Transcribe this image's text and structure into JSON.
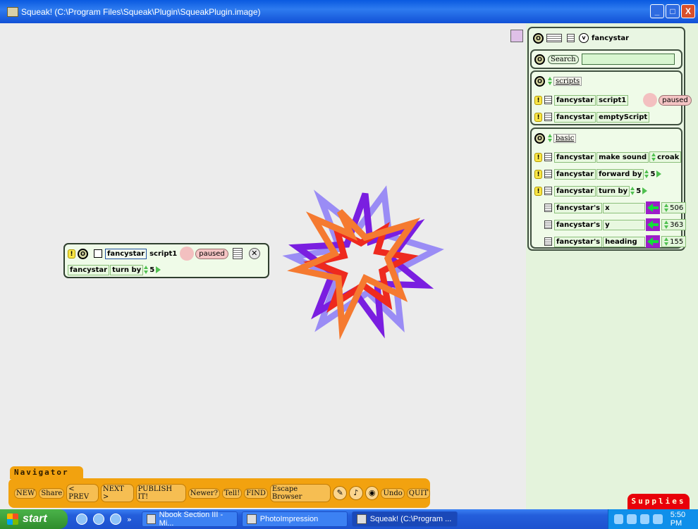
{
  "window": {
    "title": "Squeak! (C:\\Program Files\\Squeak\\Plugin\\SqueakPlugin.image)",
    "controls": {
      "minimize": "_",
      "maximize": "□",
      "close": "X"
    }
  },
  "viewer": {
    "object_name": "fancystar",
    "var_badge": "v",
    "search_button": "Search",
    "search_value": "",
    "scripts_category": {
      "label": "scripts",
      "rows": [
        {
          "subject": "fancystar",
          "command": "script1",
          "status": "paused"
        },
        {
          "subject": "fancystar",
          "command": "emptyScript"
        }
      ]
    },
    "basic_category": {
      "label": "basic",
      "commands": [
        {
          "subject": "fancystar",
          "command": "make sound",
          "arg": "croak"
        },
        {
          "subject": "fancystar",
          "command": "forward by",
          "arg": "5"
        },
        {
          "subject": "fancystar",
          "command": "turn by",
          "arg": "5"
        }
      ],
      "slots": [
        {
          "subject": "fancystar's",
          "slot": "x",
          "value": "506"
        },
        {
          "subject": "fancystar's",
          "slot": "y",
          "value": "363"
        },
        {
          "subject": "fancystar's",
          "slot": "heading",
          "value": "155"
        }
      ]
    }
  },
  "scriptor": {
    "object": "fancystar",
    "script_name": "script1",
    "status": "paused",
    "line": {
      "subject": "fancystar",
      "command": "turn by",
      "arg": "5"
    }
  },
  "navigator": {
    "tab_label": "Navigator",
    "buttons": [
      "NEW",
      "Share",
      "< PREV",
      "NEXT >",
      "PUBLISH IT!",
      "Newer?",
      "Tell!",
      "FIND",
      "Escape Browser"
    ],
    "undo": "Undo",
    "quit": "QUIT"
  },
  "supplies_label": "Supplies",
  "taskbar": {
    "start_label": "start",
    "quicklaunch_more": "»",
    "tasks": [
      {
        "label": "Nbook Section III - Mi...",
        "active": false
      },
      {
        "label": "PhotoImpression",
        "active": false
      },
      {
        "label": "Squeak! (C:\\Program ...",
        "active": true
      }
    ],
    "clock": "5:50 PM"
  },
  "colors": {
    "navigator": "#F2A20F",
    "supplies": "#E8000A",
    "star_purple": "#7A1EE0",
    "star_lavender": "#9A8CF5",
    "star_red": "#EE2A1E",
    "star_orange": "#F57A30"
  }
}
